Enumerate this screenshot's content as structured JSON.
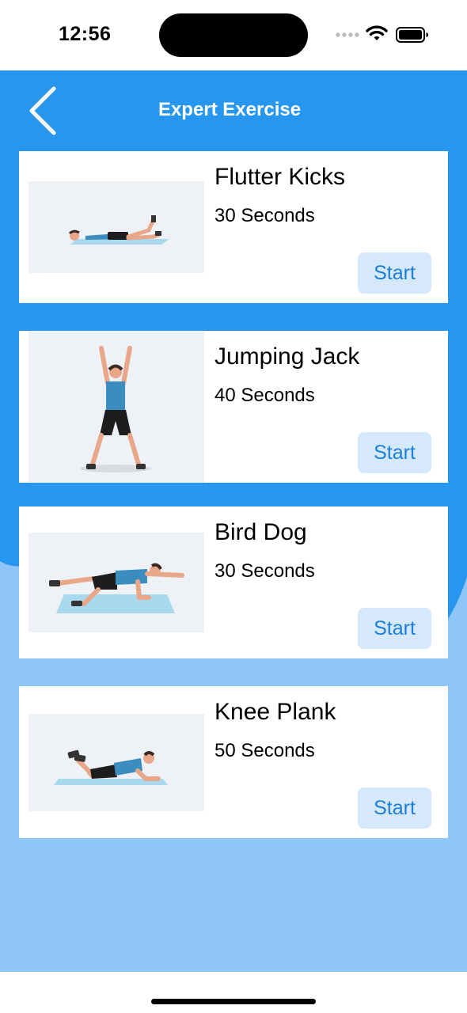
{
  "status_bar": {
    "time": "12:56"
  },
  "header": {
    "title": "Expert Exercise"
  },
  "exercises": [
    {
      "name": "Flutter Kicks",
      "duration": "30 Seconds",
      "action": "Start"
    },
    {
      "name": "Jumping Jack",
      "duration": "40 Seconds",
      "action": "Start"
    },
    {
      "name": "Bird Dog",
      "duration": "30 Seconds",
      "action": "Start"
    },
    {
      "name": "Knee Plank",
      "duration": "50 Seconds",
      "action": "Start"
    }
  ],
  "colors": {
    "header_blue": "#2696ee",
    "background_light_blue": "#8ec7f7",
    "button_bg": "#d6e8fb",
    "button_text": "#1b7fd9"
  },
  "icons": {
    "back": "chevron-left-icon",
    "wifi": "wifi-icon",
    "battery": "battery-icon"
  }
}
